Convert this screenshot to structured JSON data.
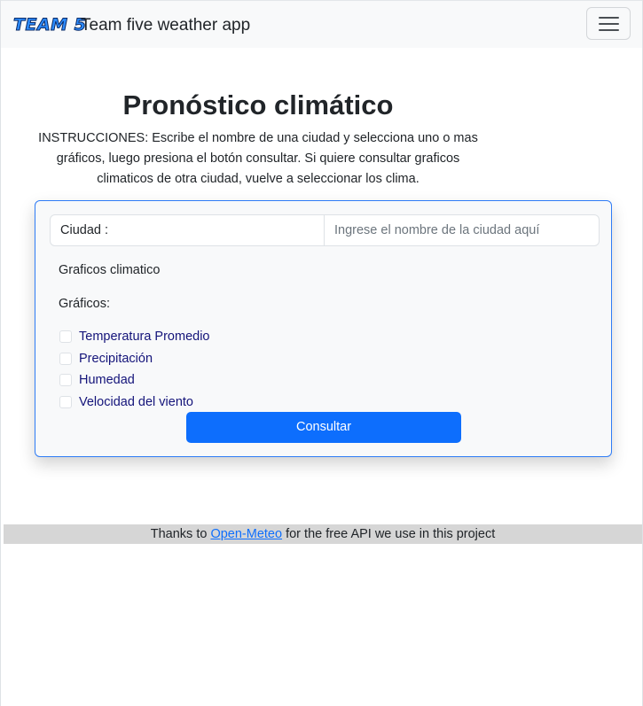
{
  "navbar": {
    "logo_text": "TEAM 5",
    "brand_text": "Team five weather app",
    "toggler_icon": "hamburger-menu-icon"
  },
  "main": {
    "title": "Pronóstico climático",
    "instructions": "INSTRUCCIONES: Escribe el nombre de una ciudad y selecciona uno o mas gráficos, luego presiona el botón consultar. Si quiere consultar graficos climaticos de otra ciudad, vuelve a seleccionar los clima."
  },
  "form": {
    "city_label": "Ciudad :",
    "city_value": "",
    "city_placeholder": "Ingrese el nombre de la ciudad aquí",
    "section_label": "Graficos climatico",
    "charts_label": "Gráficos:",
    "options": [
      {
        "label": "Temperatura Promedio",
        "checked": false
      },
      {
        "label": "Precipitación",
        "checked": false
      },
      {
        "label": "Humedad",
        "checked": false
      },
      {
        "label": "Velocidad del viento",
        "checked": false
      }
    ],
    "submit_label": "Consultar"
  },
  "footer": {
    "prefix": "Thanks to ",
    "link_text": "Open-Meteo",
    "suffix": " for the free API we use in this project"
  },
  "colors": {
    "primary": "#0d6efd",
    "card_border": "#2f7cf6",
    "navbar_bg": "#f8f9fa",
    "footer_bg": "#d6d6d6"
  }
}
